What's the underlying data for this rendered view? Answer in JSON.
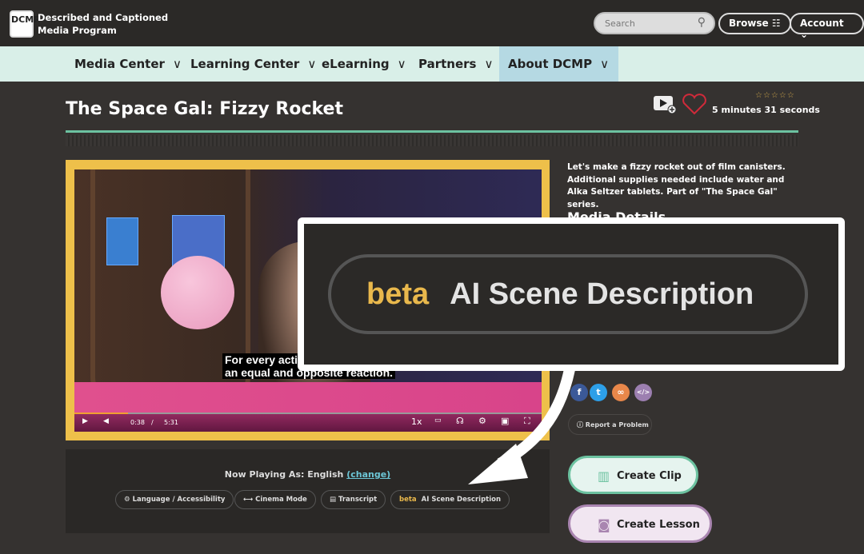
{
  "header": {
    "logo_text": "DCMP",
    "brand_line1": "Described and Captioned",
    "brand_line2": "Media Program",
    "search_placeholder": "Search",
    "browse": "Browse",
    "account": "Account"
  },
  "nav": {
    "items": [
      {
        "label": "Media Center"
      },
      {
        "label": "Learning Center"
      },
      {
        "label": "eLearning"
      },
      {
        "label": "Partners"
      },
      {
        "label": "About DCMP",
        "active": true
      }
    ]
  },
  "media": {
    "title": "The Space Gal: Fizzy Rocket",
    "rating": "☆☆☆☆☆",
    "duration": "5 minutes 31 seconds",
    "description": "Let's make a fizzy rocket out of film canisters. Additional supplies needed include water and Alka Seltzer tablets. Part of \"The Space Gal\" series.",
    "details_heading": "Media Details"
  },
  "player": {
    "caption_line1": "For every acti",
    "caption_line2": "an equal and opposite reaction.",
    "current_time": "0:38",
    "separator": "/",
    "total_time": "5:31",
    "speed": "1x",
    "progress": 0.115
  },
  "below": {
    "now_playing_label": "Now Playing As: English",
    "change": "(change)",
    "buttons": [
      {
        "label": "Language / Accessibility"
      },
      {
        "label": "Cinema Mode"
      },
      {
        "label": "Transcript"
      },
      {
        "beta": "beta",
        "label": "AI Scene Description"
      }
    ]
  },
  "sidebar": {
    "report": "Report a Problem",
    "create_clip": "Create Clip",
    "create_lesson": "Create Lesson"
  },
  "callout": {
    "beta": "beta",
    "label": "AI Scene Description"
  },
  "colors": {
    "accent_green": "#6cc2a0",
    "frame_yellow": "#eec04a",
    "beta_orange": "#e9b84c",
    "nav_bg": "#d9efe8"
  }
}
